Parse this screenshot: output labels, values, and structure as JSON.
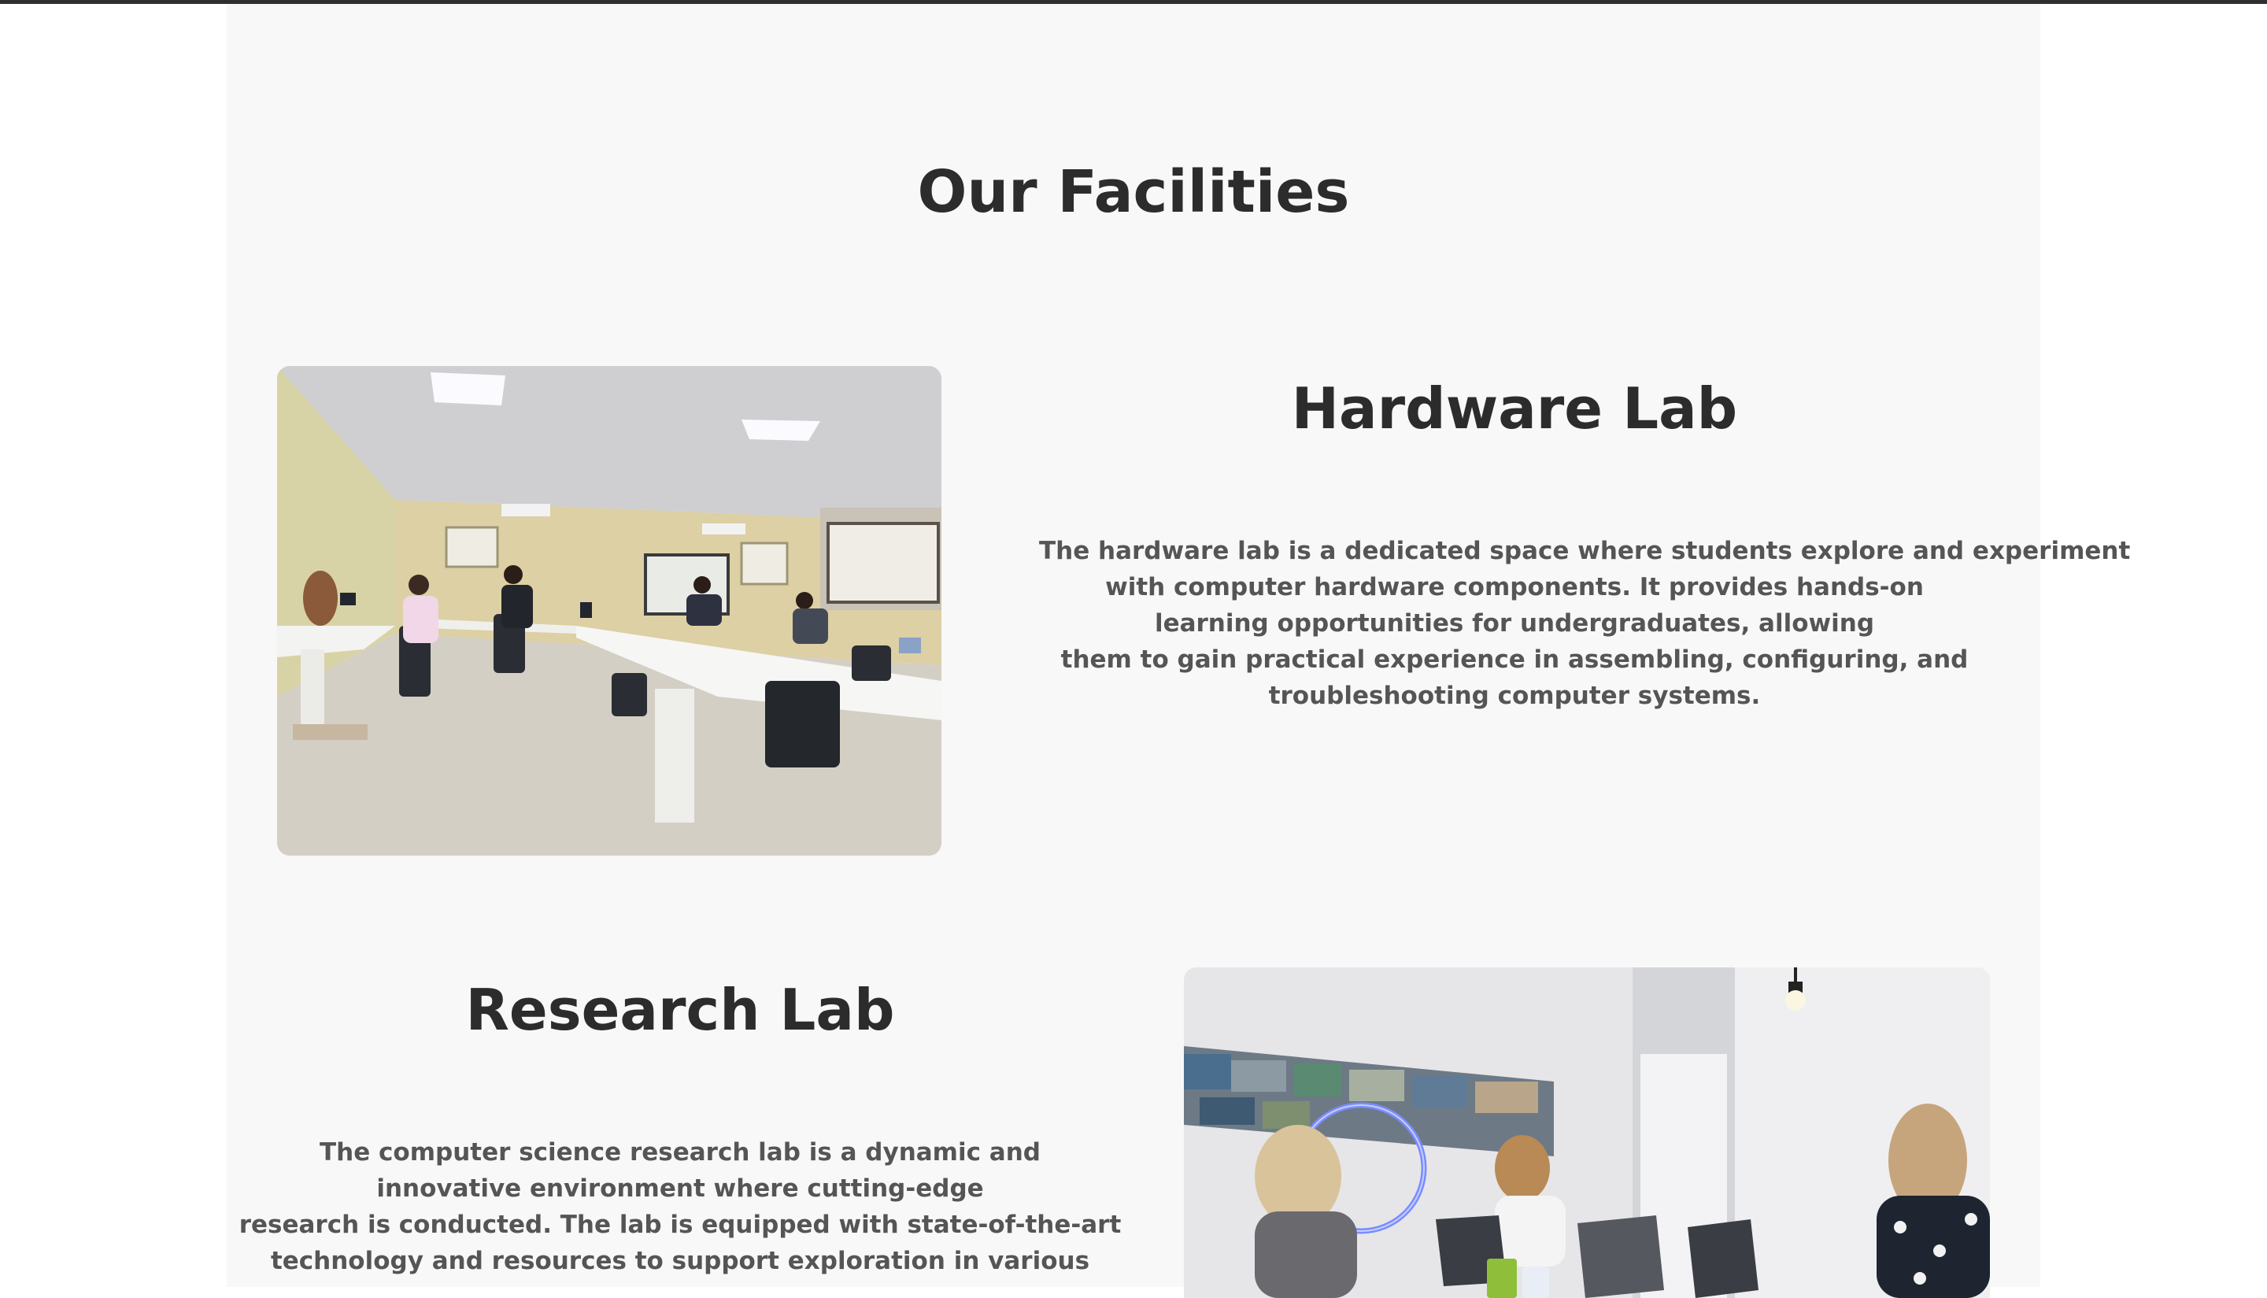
{
  "page": {
    "section_title": "Our Facilities"
  },
  "facilities": [
    {
      "title": "Hardware Lab",
      "image_alt": "Hardware lab room with students working at long white desks",
      "description_lines": [
        "The hardware lab is a dedicated space where students explore and experiment",
        "with computer hardware components. It provides hands-on",
        "learning opportunities for undergraduates, allowing",
        "them to gain practical experience in assembling, configuring, and",
        "troubleshooting computer systems."
      ]
    },
    {
      "title": "Research Lab",
      "image_alt": "Researchers working on laptops around a table",
      "description_lines": [
        "The computer science research lab is a dynamic and",
        "innovative environment where cutting-edge",
        "research is conducted. The lab is equipped with state-of-the-art",
        "technology and resources to support exploration in various"
      ]
    }
  ],
  "colors": {
    "heading": "#2c2c2c",
    "body_text": "#555555",
    "panel_background": "#f8f8f8",
    "page_background": "#ffffff",
    "top_border": "#2f2f2f"
  }
}
